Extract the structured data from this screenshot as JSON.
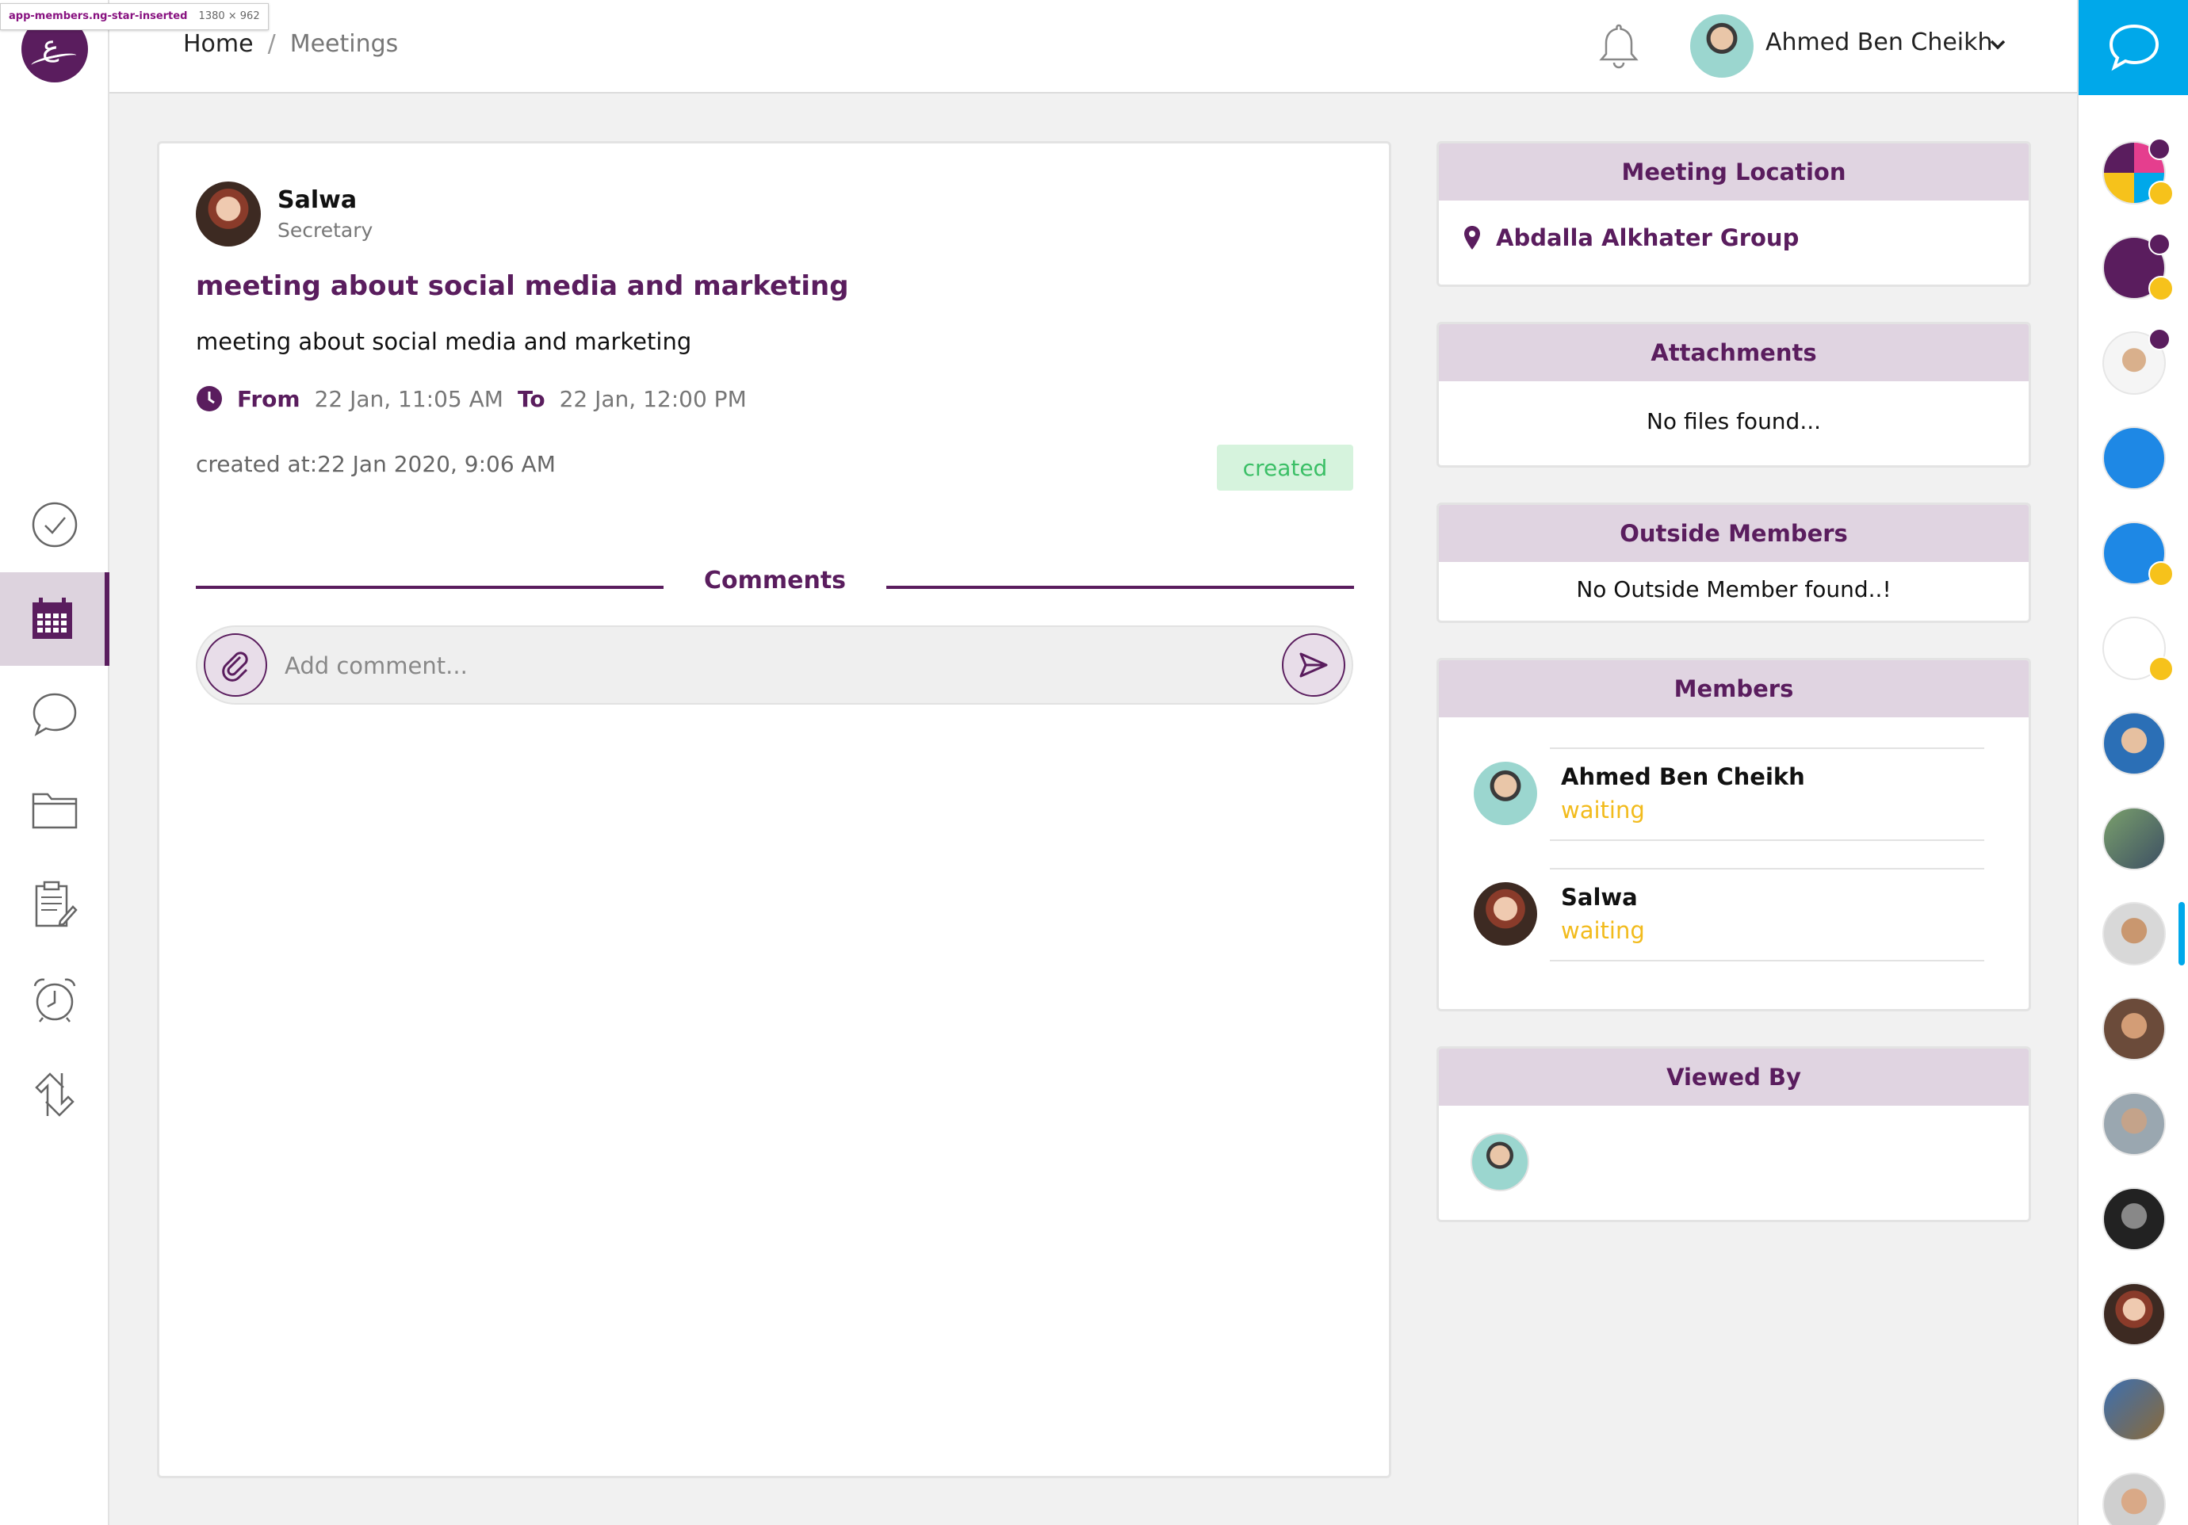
{
  "devtools_tip": {
    "selector": "app-members.ng-star-inserted",
    "size": "1380 × 962"
  },
  "breadcrumb": {
    "home": "Home",
    "separator": "/",
    "current": "Meetings"
  },
  "user": {
    "name": "Ahmed Ben Cheikh"
  },
  "sidebar": {
    "logo_glyph": "ع",
    "items": [
      {
        "name": "tasks",
        "icon": "check-circle-icon"
      },
      {
        "name": "meetings",
        "icon": "calendar-icon",
        "active": true
      },
      {
        "name": "chat",
        "icon": "chat-bubble-icon"
      },
      {
        "name": "files",
        "icon": "folder-icon"
      },
      {
        "name": "notes",
        "icon": "clipboard-pen-icon"
      },
      {
        "name": "reminders",
        "icon": "alarm-clock-icon"
      },
      {
        "name": "sync",
        "icon": "sync-arrows-icon"
      }
    ]
  },
  "meeting": {
    "author_name": "Salwa",
    "author_role": "Secretary",
    "title": "meeting about social media and marketing",
    "description": "meeting about social media and marketing",
    "from_label": "From",
    "from_value": "22 Jan, 11:05 AM",
    "to_label": "To",
    "to_value": "22 Jan, 12:00 PM",
    "created_at": "created at:22 Jan 2020, 9:06 AM",
    "status": "created"
  },
  "comments": {
    "title": "Comments",
    "placeholder": "Add comment..."
  },
  "panels": {
    "location": {
      "title": "Meeting Location",
      "value": "Abdalla Alkhater Group"
    },
    "attachments": {
      "title": "Attachments",
      "empty": "No files found..."
    },
    "outside_members": {
      "title": "Outside Members",
      "empty": "No Outside Member found..!"
    },
    "members": {
      "title": "Members",
      "items": [
        {
          "name": "Ahmed Ben Cheikh",
          "status": "waiting"
        },
        {
          "name": "Salwa",
          "status": "waiting"
        }
      ]
    },
    "viewed_by": {
      "title": "Viewed By"
    }
  },
  "colors": {
    "brand": "#5a1d5e",
    "panel_header": "#e0d4e1",
    "status_waiting": "#f2bb1c",
    "status_created_bg": "#d6f3dd",
    "status_created_text": "#3bbf66",
    "chat_accent": "#00a8ea"
  }
}
